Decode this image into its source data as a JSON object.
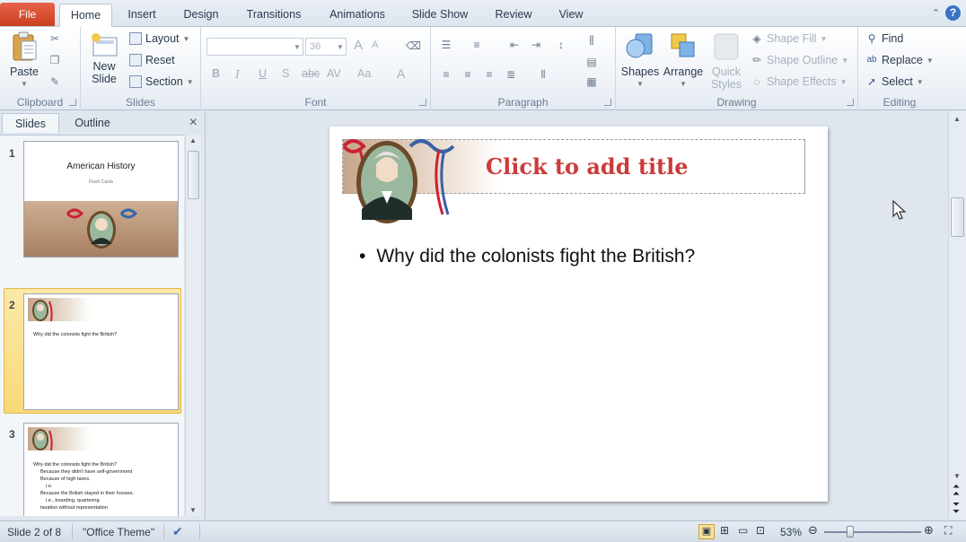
{
  "tabs": {
    "file": "File",
    "items": [
      "Home",
      "Insert",
      "Design",
      "Transitions",
      "Animations",
      "Slide Show",
      "Review",
      "View"
    ],
    "active": "Home"
  },
  "help_label": "?",
  "ribbon": {
    "clipboard": {
      "label": "Clipboard",
      "paste": "Paste"
    },
    "slides": {
      "label": "Slides",
      "new_slide_1": "New",
      "new_slide_2": "Slide",
      "layout": "Layout",
      "reset": "Reset",
      "section": "Section"
    },
    "font": {
      "label": "Font",
      "font_name": "",
      "font_size": "36",
      "bold": "B",
      "italic": "I",
      "underline": "U",
      "shadow": "S",
      "strike": "abc",
      "spacing": "AV",
      "case": "Aa",
      "color": "A",
      "grow": "A",
      "shrink": "A"
    },
    "paragraph": {
      "label": "Paragraph"
    },
    "drawing": {
      "label": "Drawing",
      "shapes": "Shapes",
      "arrange": "Arrange",
      "quick_styles_1": "Quick",
      "quick_styles_2": "Styles",
      "shape_fill": "Shape Fill",
      "shape_outline": "Shape Outline",
      "shape_effects": "Shape Effects"
    },
    "editing": {
      "label": "Editing",
      "find": "Find",
      "replace": "Replace",
      "select": "Select"
    }
  },
  "panel": {
    "tabs": [
      "Slides",
      "Outline"
    ],
    "active_tab": "Slides",
    "close": "×",
    "slides": [
      {
        "num": "1",
        "title": "American History",
        "subtitle": "Flash Cards"
      },
      {
        "num": "2",
        "bullet": "Why did the colonists fight the British?"
      },
      {
        "num": "3",
        "bullet": "Why did the colonists fight the British?",
        "subs": [
          "Because they didn't have self-government",
          "Because of high taxes.",
          "i.e.",
          "Because the British stayed in their houses.",
          "i.e., boarding, quartering",
          "taxation without representation"
        ]
      }
    ],
    "selected_index": 1
  },
  "slide": {
    "title_placeholder": "Click to add title",
    "bullet_char": "•",
    "bullet_text": "Why did the colonists fight the British?"
  },
  "status": {
    "slide_of": "Slide 2 of 8",
    "theme": "\"Office Theme\"",
    "zoom": "53%",
    "zoom_fraction": 0.3
  },
  "colors": {
    "title_red": "#cc3a3a",
    "file_tab": "#d24a2a",
    "selected_thumb": "#f8d978"
  }
}
